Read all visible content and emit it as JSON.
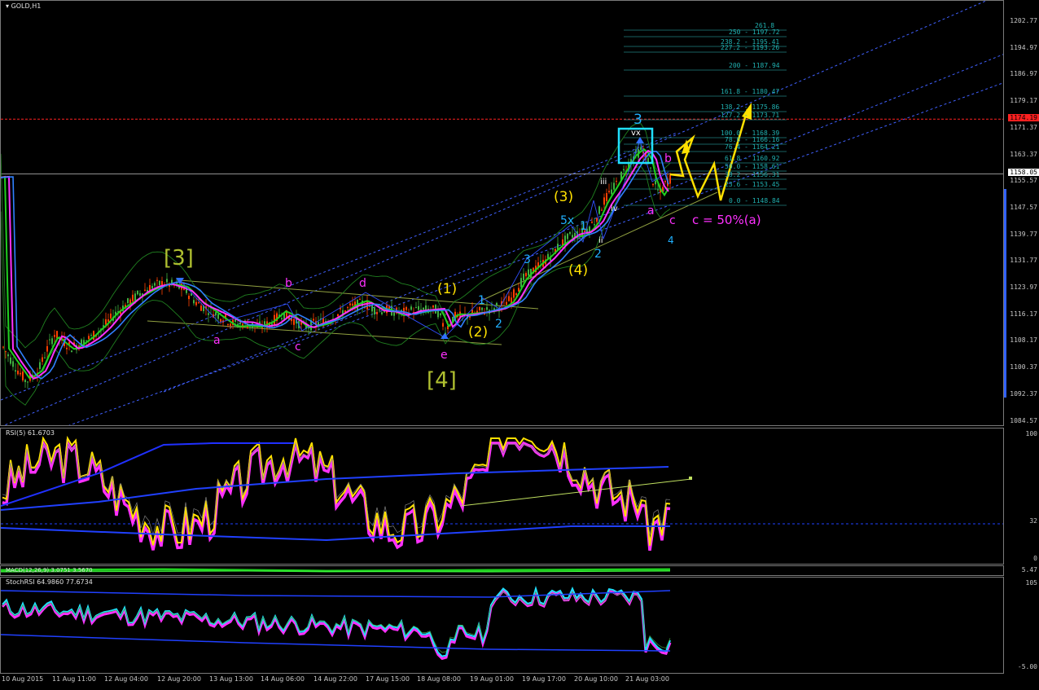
{
  "chart_title": "GOLD,H1",
  "colors": {
    "background": "#000000",
    "candle_up": "#ff4000",
    "candle_down": "#40b040",
    "channel": "#4060ff",
    "ma_fast": "#20d020",
    "ma_mid": "#ff30ff",
    "ma_slow": "#3080ff",
    "bollinger": "#208020",
    "wave_yellow": "#ffe000",
    "wave_magenta": "#ff30ff",
    "wave_cyan": "#20b0ff",
    "wave_olive": "#b0c030",
    "resistance": "#ff2020",
    "current_price_line": "#c0c0c0"
  },
  "main": {
    "y_labels": [
      "1202.77",
      "1194.97",
      "1186.97",
      "1179.17",
      "1171.37",
      "1163.37",
      "1155.57",
      "1147.57",
      "1139.77",
      "1131.77",
      "1123.97",
      "1116.17",
      "1108.17",
      "1100.37",
      "1092.37",
      "1084.57"
    ],
    "current_price": "1158.05",
    "resistance_price": "1174.19",
    "fib_levels": [
      "261.8",
      "250 - 1197.72",
      "238.2 - 1195.41",
      "227.2 - 1193.26",
      "200 - 1187.94",
      "161.8 - 1180.47",
      "138.2 - 1175.86",
      "127.2 - 1173.71",
      "100.0 - 1168.39",
      "78.6 - 1166.16",
      "76.4 - 1164.21",
      "61.8 - 1160.92",
      "50.0 - 1158.61",
      "38.2 - 1156.31",
      "23.6 - 1153.45",
      "0.0 - 1148.84"
    ],
    "wave_labels": {
      "big3": "[3]",
      "big4": "[4]",
      "w1": "(1)",
      "w2": "(2)",
      "w3": "(3)",
      "w4": "(4)",
      "a1": "a",
      "b1": "b",
      "c1": "c",
      "d1": "d",
      "e1": "e",
      "top3": "3",
      "vx": "vx",
      "iii": "iii",
      "iv": "iv",
      "ii": "ii",
      "s1": "1",
      "s2": "2",
      "s3": "3",
      "s5x": "5x",
      "s1b": "1",
      "s2b": "2",
      "s4": "4",
      "a2": "a",
      "b2": "b",
      "c2": "c",
      "note": "c = 50%(a)"
    }
  },
  "rsi": {
    "title": "RSI(5) 61.6703",
    "y_labels": [
      "100",
      "32",
      "0"
    ]
  },
  "macd": {
    "title": "MACD(12,26,9) 3.0751 3.5670",
    "y_labels": [
      "5.47"
    ]
  },
  "stoch": {
    "title": "StochRSI 64.9860 77.6734",
    "y_labels": [
      "105",
      "-5.00"
    ]
  },
  "x_labels": [
    "10 Aug 2015",
    "11 Aug 11:00",
    "12 Aug 04:00",
    "12 Aug 20:00",
    "13 Aug 13:00",
    "14 Aug 06:00",
    "14 Aug 22:00",
    "17 Aug 15:00",
    "18 Aug 08:00",
    "19 Aug 01:00",
    "19 Aug 17:00",
    "20 Aug 10:00",
    "21 Aug 03:00"
  ]
}
